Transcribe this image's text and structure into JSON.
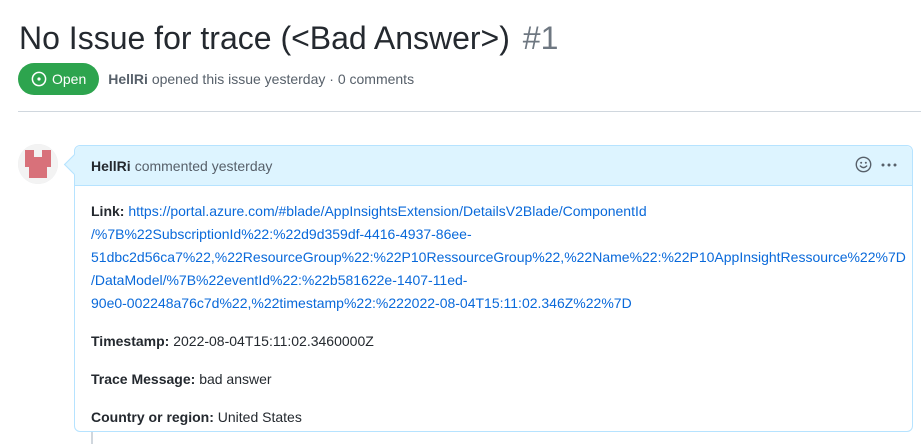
{
  "issue": {
    "title": "No Issue for trace (<Bad Answer>)",
    "number": "#1",
    "state": "Open",
    "author": "HellRi",
    "opened_text": "opened this issue yesterday · 0 comments"
  },
  "comment": {
    "author": "HellRi",
    "time_text": "commented yesterday",
    "fields": {
      "link_label": "Link:",
      "link_lines": [
        "https://portal.azure.com/#blade/AppInsightsExtension/DetailsV2Blade/ComponentId",
        "/%7B%22SubscriptionId%22:%22d9d359df-4416-4937-86ee-",
        "51dbc2d56ca7%22,%22ResourceGroup%22:%22P10RessourceGroup%22,%22Name%22:%22P10AppInsightRessource%22%7D",
        "/DataModel/%7B%22eventId%22:%22b581622e-1407-11ed-",
        "90e0-002248a76c7d%22,%22timestamp%22:%222022-08-04T15:11:02.346Z%22%7D"
      ],
      "timestamp_label": "Timestamp:",
      "timestamp_value": "2022-08-04T15:11:02.3460000Z",
      "trace_label": "Trace Message:",
      "trace_value": "bad answer",
      "country_label": "Country or region:",
      "country_value": "United States"
    }
  },
  "icons": {
    "state": "issue-opened-icon",
    "reaction": "smiley-icon",
    "menu": "kebab-horizontal-icon",
    "avatar": "identicon-avatar"
  },
  "colors": {
    "open_green": "#2da44e",
    "link_blue": "#0969da",
    "header_blue": "#ddf4ff",
    "avatar_red": "#d8717a"
  }
}
